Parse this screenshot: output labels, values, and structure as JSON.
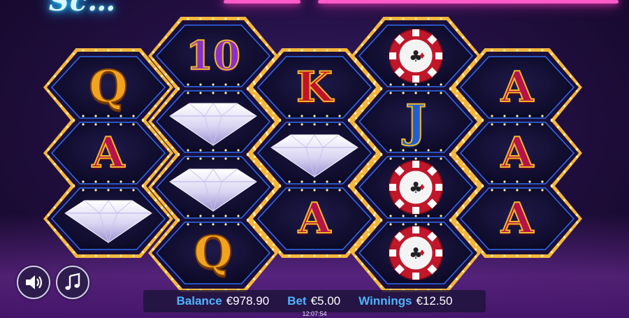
{
  "game": {
    "title_logo": "Sc...",
    "reels": [
      [
        "Q",
        "A",
        "diamond"
      ],
      [
        "10",
        "diamond",
        "diamond",
        "Q"
      ],
      [
        "K",
        "diamond",
        "A"
      ],
      [
        "chip",
        "J",
        "chip",
        "chip"
      ],
      [
        "A",
        "A",
        "A"
      ]
    ]
  },
  "controls": {
    "sound_icon": "speaker-icon",
    "music_icon": "music-note-icon"
  },
  "status_bar": {
    "balance_label": "Balance",
    "balance_value": "€978.90",
    "bet_label": "Bet",
    "bet_value": "€5.00",
    "winnings_label": "Winnings",
    "winnings_value": "€12.50"
  },
  "clock": "12:07:54",
  "colors": {
    "frame_gold": "#f5b73b",
    "neon_pink": "#ff3bbf",
    "neon_blue": "#35d6ff",
    "label_blue": "#4fb3ff",
    "cell_fill": "#0f0b2c",
    "cell_border": "#2e6cf0"
  }
}
